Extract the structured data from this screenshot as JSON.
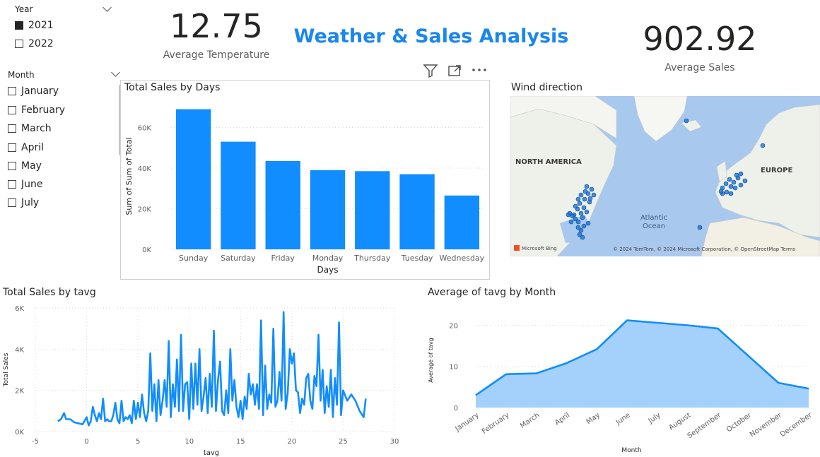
{
  "year_slicer": {
    "title": "Year",
    "options": [
      {
        "label": "2021",
        "checked": true
      },
      {
        "label": "2022",
        "checked": false
      }
    ]
  },
  "month_slicer": {
    "title": "Month",
    "options": [
      {
        "label": "January"
      },
      {
        "label": "February"
      },
      {
        "label": "March"
      },
      {
        "label": "April"
      },
      {
        "label": "May"
      },
      {
        "label": "June"
      },
      {
        "label": "July"
      }
    ]
  },
  "kpi_temp": {
    "value": "12.75",
    "label": "Average Temperature"
  },
  "report_title": "Weather & Sales Analysis",
  "kpi_sales": {
    "value": "902.92",
    "label": "Average Sales"
  },
  "colors": {
    "accent": "#118DFF",
    "title": "#1A86F0",
    "area_fill": "#9ECFFB"
  },
  "map": {
    "title": "Wind direction",
    "labels": {
      "north_america": "NORTH AMERICA",
      "europe": "EUROPE",
      "ocean": "Atlantic\nOcean"
    },
    "ocean_l1": "Atlantic",
    "ocean_l2": "Ocean",
    "logo": "Microsoft Bing",
    "attribution": "© 2024 TomTom, © 2024 Microsoft Corporation, © OpenStreetMap  Terms"
  },
  "chart_data": [
    {
      "type": "bar",
      "title": "Total Sales by Days",
      "xlabel": "Days",
      "ylabel": "Sum of Sum of Total",
      "categories": [
        "Sunday",
        "Saturday",
        "Friday",
        "Monday",
        "Thursday",
        "Tuesday",
        "Wednesday"
      ],
      "values": [
        69000,
        53000,
        43500,
        39000,
        38500,
        37000,
        26500
      ],
      "ylim": [
        0,
        72000
      ],
      "yticks": [
        0,
        20000,
        40000,
        60000
      ],
      "ytick_labels": [
        "0K",
        "20K",
        "40K",
        "60K"
      ],
      "grid": true
    },
    {
      "type": "line",
      "title": "Total Sales by tavg",
      "xlabel": "tavg",
      "ylabel": "Total Sales",
      "xlim": [
        -5,
        30
      ],
      "ylim": [
        0,
        6000
      ],
      "xticks": [
        -5,
        0,
        5,
        10,
        15,
        20,
        25,
        30
      ],
      "yticks": [
        0,
        2000,
        4000,
        6000
      ],
      "ytick_labels": [
        "0K",
        "2K",
        "4K",
        "6K"
      ],
      "grid": true,
      "x": [
        -2.8,
        -2.5,
        -2.2,
        -2,
        -1.6,
        -1.2,
        -0.8,
        -0.4,
        0,
        0.2,
        0.4,
        0.6,
        0.8,
        1,
        1.2,
        1.4,
        1.6,
        1.8,
        2,
        2.2,
        2.4,
        2.6,
        2.8,
        3,
        3.2,
        3.4,
        3.6,
        3.8,
        4,
        4.2,
        4.4,
        4.6,
        4.8,
        5,
        5.2,
        5.4,
        5.6,
        5.8,
        6,
        6.2,
        6.4,
        6.6,
        6.8,
        7,
        7.2,
        7.4,
        7.6,
        7.8,
        8,
        8.2,
        8.4,
        8.6,
        8.8,
        9,
        9.2,
        9.4,
        9.6,
        9.8,
        10,
        10.2,
        10.4,
        10.6,
        10.8,
        11,
        11.2,
        11.4,
        11.6,
        11.8,
        12,
        12.2,
        12.4,
        12.6,
        12.8,
        13,
        13.2,
        13.4,
        13.6,
        13.8,
        14,
        14.2,
        14.4,
        14.6,
        14.8,
        15,
        15.2,
        15.4,
        15.6,
        15.8,
        16,
        16.2,
        16.4,
        16.6,
        16.8,
        17,
        17.2,
        17.4,
        17.6,
        17.8,
        18,
        18.2,
        18.4,
        18.6,
        18.8,
        19,
        19.2,
        19.4,
        19.6,
        19.8,
        20,
        20.2,
        20.4,
        20.6,
        20.8,
        21,
        21.2,
        21.4,
        21.6,
        21.8,
        22,
        22.2,
        22.4,
        22.6,
        22.8,
        23,
        23.2,
        23.4,
        23.6,
        23.8,
        24,
        24.2,
        24.4,
        24.6,
        24.8,
        25,
        25.4,
        25.8,
        26.2,
        26.6,
        27,
        27.2
      ],
      "y": [
        500,
        600,
        900,
        600,
        600,
        450,
        400,
        350,
        700,
        300,
        500,
        1200,
        800,
        500,
        900,
        600,
        1600,
        500,
        600,
        500,
        500,
        800,
        1400,
        600,
        400,
        1500,
        500,
        700,
        600,
        800,
        400,
        1500,
        600,
        1400,
        700,
        1800,
        900,
        500,
        1000,
        3800,
        1000,
        2300,
        500,
        2500,
        800,
        1500,
        2500,
        1200,
        4400,
        700,
        2300,
        1200,
        3500,
        1000,
        4700,
        1000,
        2300,
        2400,
        600,
        3300,
        1100,
        3300,
        1300,
        4000,
        1000,
        1700,
        2600,
        900,
        2800,
        1200,
        4900,
        1000,
        2500,
        3400,
        1000,
        800,
        2000,
        900,
        4000,
        1500,
        2500,
        1200,
        700,
        1500,
        600,
        1700,
        1100,
        2800,
        1800,
        2300,
        1300,
        2300,
        1100,
        5400,
        800,
        3200,
        1100,
        1800,
        1400,
        5000,
        1200,
        1500,
        2900,
        1500,
        5800,
        1100,
        1900,
        4000,
        3300,
        3800,
        2000,
        1900,
        900,
        1600,
        1300,
        2600,
        2800,
        1500,
        1100,
        2700,
        2200,
        4700,
        1500,
        3000,
        900,
        2200,
        1200,
        3000,
        700,
        2600,
        1300,
        5300,
        800,
        2000,
        1500,
        1800,
        1500,
        1000,
        700,
        1600,
        2000,
        2600
      ]
    },
    {
      "type": "area",
      "title": "Average of tavg by Month",
      "xlabel": "Month",
      "ylabel": "Average of tavg",
      "categories": [
        "January",
        "February",
        "March",
        "April",
        "May",
        "June",
        "July",
        "August",
        "September",
        "October",
        "November",
        "December"
      ],
      "values": [
        3.0,
        8.1,
        8.3,
        10.8,
        14.2,
        21.2,
        20.6,
        20.0,
        19.2,
        12.6,
        6.0,
        4.6
      ],
      "ylim": [
        0,
        23
      ],
      "yticks": [
        0,
        10,
        20
      ],
      "grid": true
    }
  ]
}
